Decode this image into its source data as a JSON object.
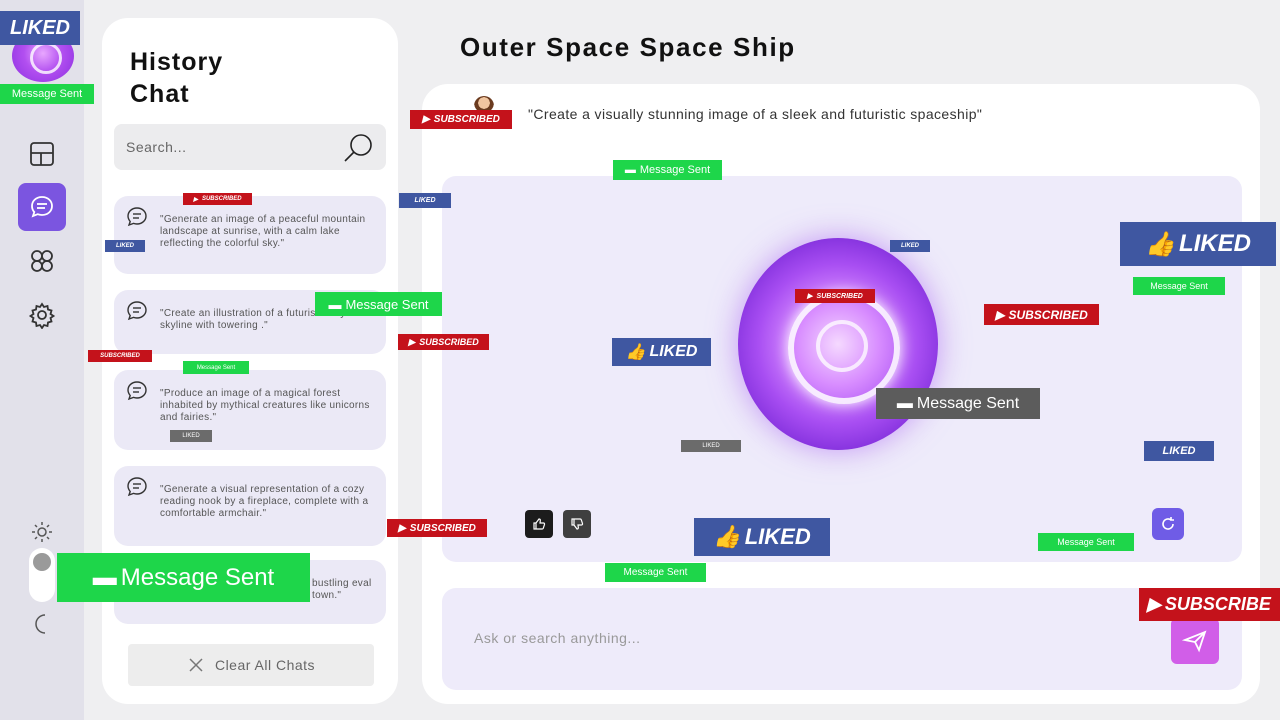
{
  "sidebar": {
    "items": [
      {
        "name": "layout-icon"
      },
      {
        "name": "chat-icon",
        "active": true
      },
      {
        "name": "community-icon"
      },
      {
        "name": "settings-icon"
      }
    ],
    "theme": {
      "light_icon": "sun-icon",
      "dark_icon": "moon-icon",
      "mode": "light"
    }
  },
  "history": {
    "title": "History Chat",
    "search_placeholder": "Search...",
    "chats": [
      "\"Generate an image of a peaceful mountain landscape at sunrise, with a calm lake reflecting the colorful sky.\"",
      "\"Create an illustration of a futuristic city skyline with towering .\"",
      "\"Produce an image of a magical forest inhabited by mythical creatures like unicorns and fairies.\"",
      "\"Generate a visual representation of a cozy reading nook by a fireplace, complete with a comfortable armchair.\"",
      "bustling eval town.\""
    ],
    "clear_label": "Clear All Chats"
  },
  "main": {
    "title": "Outer Space Space Ship",
    "prompt": "\"Create a visually stunning image of a sleek and futuristic spaceship\"",
    "ask_placeholder": "Ask or search anything..."
  },
  "overlays": {
    "liked": "LIKED",
    "subscribed": "SUBSCRIBED",
    "subscribe_partial": "SUBSCRIBE",
    "message_sent": "Message Sent"
  },
  "colors": {
    "accent": "#7b55e0",
    "send": "#d15ee8",
    "liked": "#3f57a1",
    "subscribed": "#c4121b",
    "message_sent": "#1ed64a"
  }
}
